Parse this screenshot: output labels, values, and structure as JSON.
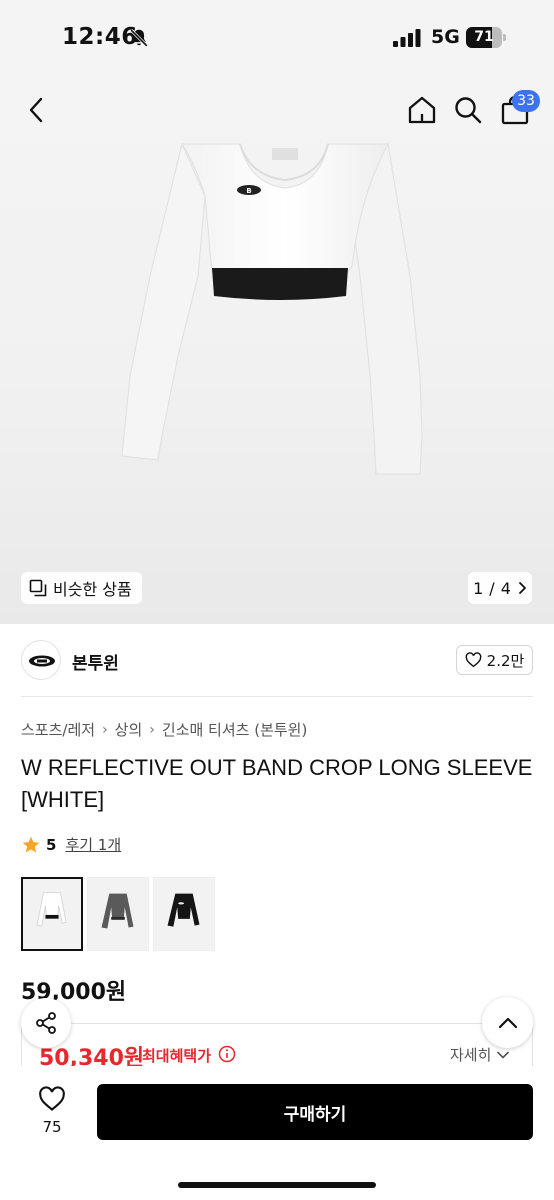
{
  "status_bar": {
    "time": "12:46",
    "network": "5G",
    "battery_level": "71",
    "battery_fraction": 0.71,
    "icons": [
      "bell-slash-icon",
      "signal-icon",
      "battery-icon"
    ]
  },
  "header": {
    "icons": [
      "chevron-left-icon",
      "home-icon",
      "search-icon",
      "shopping-bag-icon"
    ],
    "cart_count": "33",
    "badge_color": "#3d73f0"
  },
  "gallery": {
    "similar_label": "비슷한 상품",
    "page_current": "1",
    "page_sep": "/",
    "page_total": "4"
  },
  "brand": {
    "name": "본투윈",
    "like_count": "2.2만"
  },
  "breadcrumb": [
    "스포츠/레저",
    "상의",
    "긴소매 티셔츠 (본투윈)"
  ],
  "product": {
    "title": "W REFLECTIVE OUT BAND CROP LONG SLEEVE [WHITE]",
    "rating": "5",
    "review_label": "후기 1개",
    "variant_colors": [
      "white",
      "gray",
      "black"
    ],
    "price": "59,000원",
    "benefit_price": "50,340원",
    "benefit_label": "최대혜택가",
    "detail_label": "자세히",
    "accent_red": "#e8282d"
  },
  "bottom_bar": {
    "wish_count": "75",
    "buy_label": "구매하기"
  }
}
